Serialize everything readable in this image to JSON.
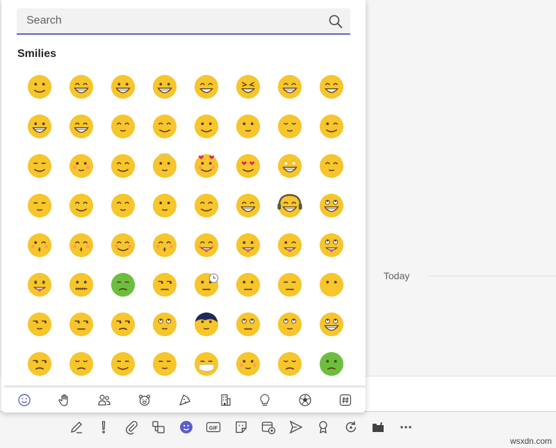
{
  "search": {
    "placeholder": "Search"
  },
  "section": {
    "title": "Smilies"
  },
  "timeline": {
    "today_label": "Today"
  },
  "toolbar": {
    "gif_label": "GIF",
    "more_label": "···"
  },
  "watermark": "wsxdn.com",
  "colors": {
    "accent": "#5b5fc7",
    "emoji_yellow": "#f7c52c",
    "emoji_green": "#6cbf3e"
  },
  "emojis": [
    "smile",
    "laugh",
    "big-smile",
    "grin",
    "happy",
    "squinting-laugh",
    "sweat-laugh",
    "rolling-laugh",
    "silly",
    "tears-of-joy",
    "giggle",
    "smirk-up",
    "content",
    "innocent-smile",
    "calm",
    "wink",
    "relieved",
    "blush",
    "smile-closed-eyes",
    "angel",
    "hearts",
    "heart-eyes",
    "star-struck",
    "shy-hand",
    "sneeze",
    "clap",
    "hand-on-face",
    "thinking",
    "facepalm",
    "salute",
    "headphones",
    "nerd-teeth",
    "kiss-heart",
    "kissing",
    "blushing",
    "blush-kiss",
    "yummy",
    "tongue-out",
    "tongue-wink",
    "crazy",
    "money-mouth",
    "zipped-mouth",
    "angry-green",
    "side-eye",
    "waiting",
    "neutral",
    "expressionless",
    "no-mouth",
    "smug",
    "unamused",
    "eye-roll",
    "wondering",
    "emo",
    "rolling-eyes",
    "thinking-up",
    "grimace",
    "puzzled",
    "worried",
    "relieved-sigh",
    "sleepy",
    "mask",
    "confused-blush",
    "injured",
    "nauseated"
  ],
  "categories": [
    "smilies",
    "hand-gestures",
    "people",
    "animals",
    "food",
    "places",
    "objects",
    "activities",
    "symbols"
  ]
}
